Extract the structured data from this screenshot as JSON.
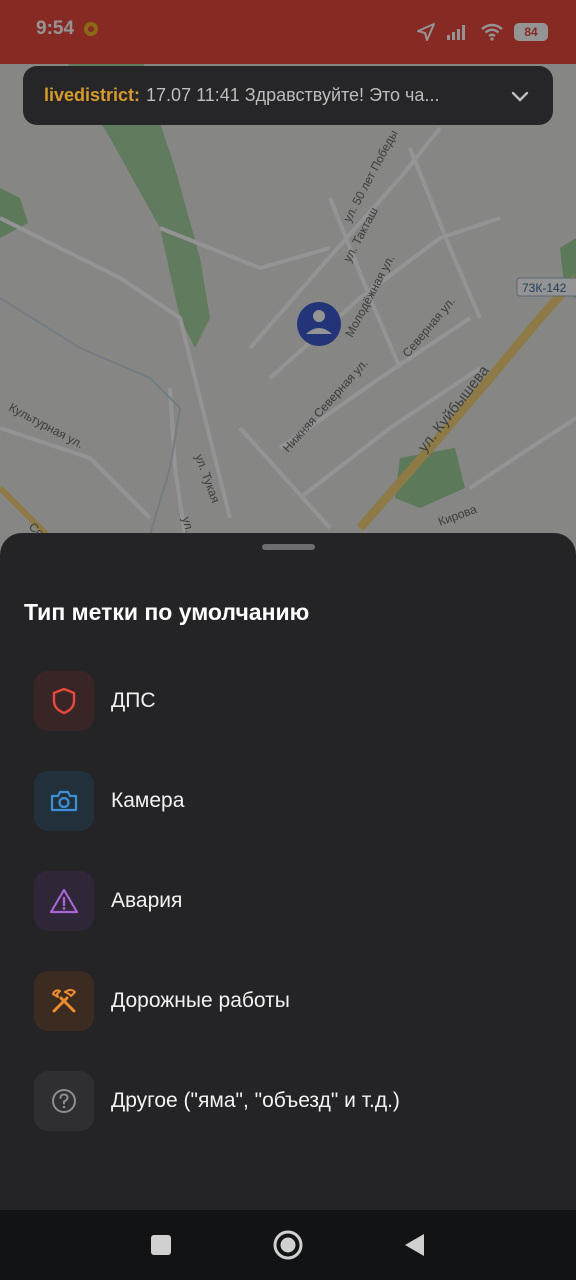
{
  "status_bar": {
    "time": "9:54",
    "battery": "84"
  },
  "map": {
    "streets": [
      "ул. 50 лет Победы",
      "ул. Такташ",
      "Молодёжная ул.",
      "Северная ул.",
      "Нижняя Северная ул.",
      "ул. Куйбышева",
      "Культурная ул.",
      "ул. Тукая",
      "Кирова",
      "ул.",
      "Со"
    ],
    "route_badge": "73К-142"
  },
  "chat_banner": {
    "user": "livedistrict:",
    "message": "17.07 11:41 Здравствуйте! Это ча..."
  },
  "sheet": {
    "title": "Тип метки по умолчанию",
    "items": [
      {
        "label": "ДПС",
        "icon": "shield-icon",
        "color": "#e8493f",
        "bg": "#3a2526"
      },
      {
        "label": "Камера",
        "icon": "camera-icon",
        "color": "#3d8fd6",
        "bg": "#22303c"
      },
      {
        "label": "Авария",
        "icon": "warning-icon",
        "color": "#a765d6",
        "bg": "#2f2638"
      },
      {
        "label": "Дорожные работы",
        "icon": "tools-icon",
        "color": "#ef8c2e",
        "bg": "#3b2b20"
      },
      {
        "label": "Другое (\"яма\", \"объезд\" и т.д.)",
        "icon": "question-icon",
        "color": "#8e8e90",
        "bg": "#2f2f31"
      }
    ]
  }
}
